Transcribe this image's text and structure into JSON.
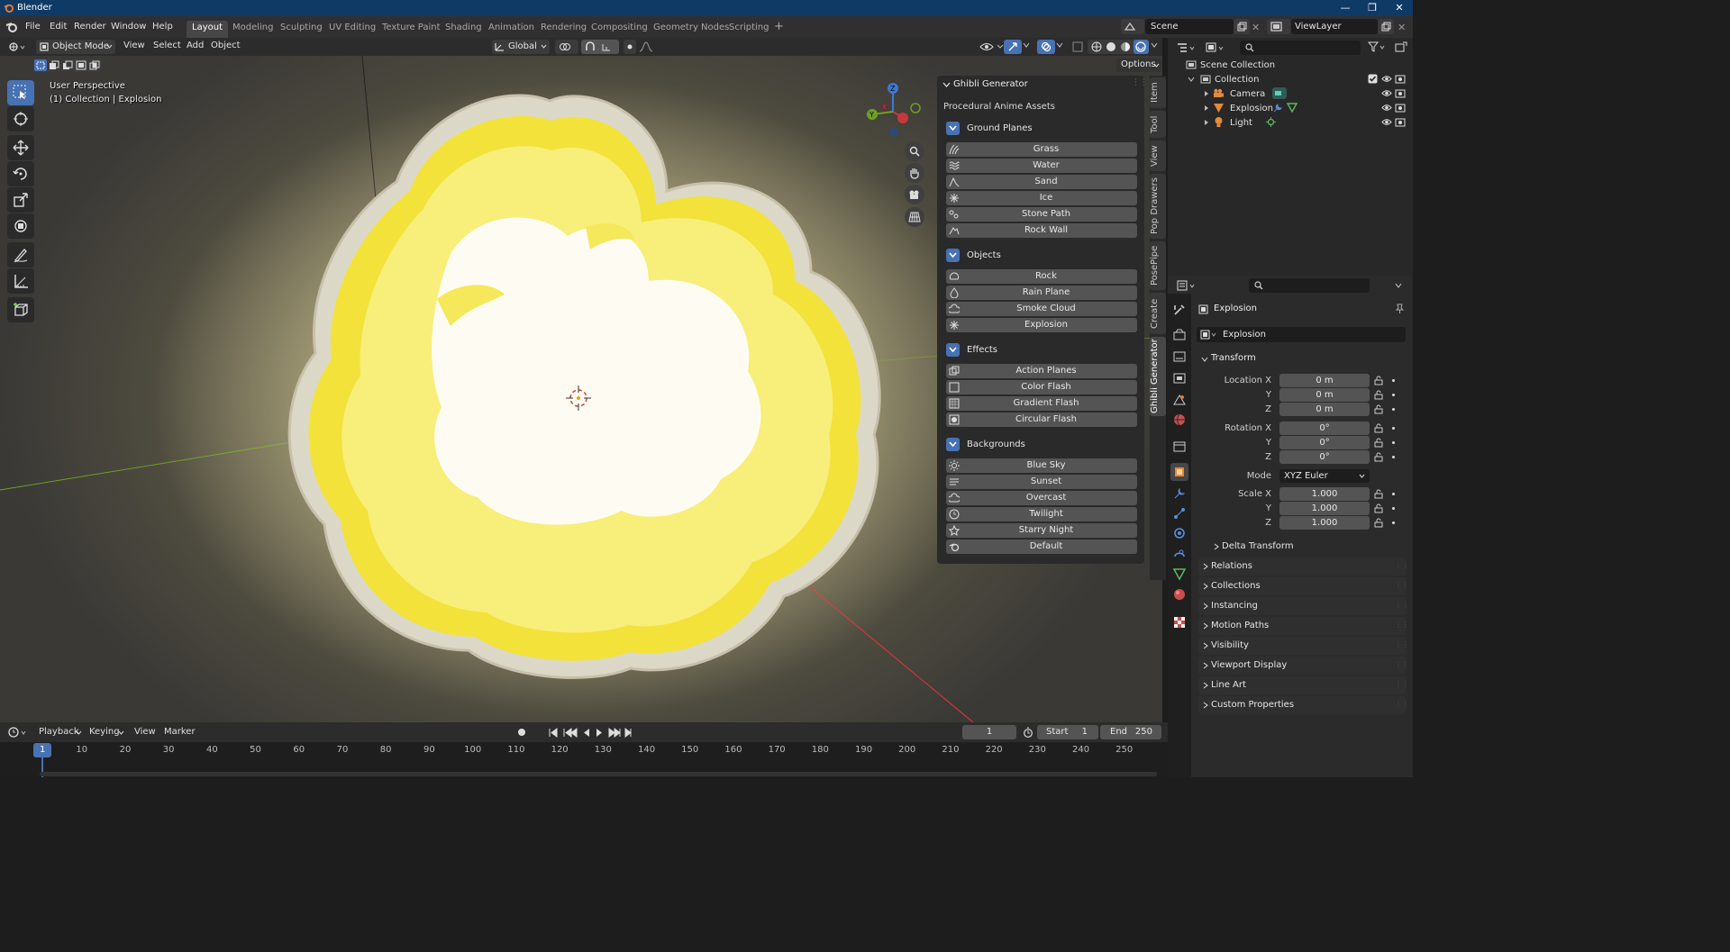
{
  "window": {
    "title": "Blender"
  },
  "menu": {
    "items": [
      "File",
      "Edit",
      "Render",
      "Window",
      "Help"
    ]
  },
  "workspaces": [
    {
      "label": "Layout",
      "active": true
    },
    {
      "label": "Modeling"
    },
    {
      "label": "Sculpting"
    },
    {
      "label": "UV Editing"
    },
    {
      "label": "Texture Paint"
    },
    {
      "label": "Shading"
    },
    {
      "label": "Animation"
    },
    {
      "label": "Rendering"
    },
    {
      "label": "Compositing"
    },
    {
      "label": "Geometry Nodes"
    },
    {
      "label": "Scripting"
    }
  ],
  "scene": {
    "name": "Scene",
    "view_layer": "ViewLayer"
  },
  "viewport_header": {
    "mode": "Object Mode",
    "menus": [
      "View",
      "Select",
      "Add",
      "Object"
    ],
    "orientation": "Global",
    "options": "Options"
  },
  "viewport": {
    "perspective": "User Perspective",
    "collection_info": "(1) Collection | Explosion",
    "gizmo_axes": {
      "x": "X",
      "y": "Y",
      "z": "Z"
    }
  },
  "ghibli_panel": {
    "title": "Ghibli Generator",
    "subtitle": "Procedural Anime Assets",
    "sections": [
      {
        "title": "Ground Planes",
        "items": [
          {
            "label": "Grass",
            "icon": "grass-icon"
          },
          {
            "label": "Water",
            "icon": "water-icon"
          },
          {
            "label": "Sand",
            "icon": "sand-icon"
          },
          {
            "label": "Ice",
            "icon": "snowflake-icon"
          },
          {
            "label": "Stone Path",
            "icon": "stone-path-icon"
          },
          {
            "label": "Rock Wall",
            "icon": "rock-wall-icon"
          }
        ]
      },
      {
        "title": "Objects",
        "items": [
          {
            "label": "Rock",
            "icon": "rock-icon"
          },
          {
            "label": "Rain Plane",
            "icon": "raindrop-icon"
          },
          {
            "label": "Smoke Cloud",
            "icon": "cloud-icon"
          },
          {
            "label": "Explosion",
            "icon": "burst-icon"
          }
        ]
      },
      {
        "title": "Effects",
        "items": [
          {
            "label": "Action Planes",
            "icon": "planes-icon"
          },
          {
            "label": "Color Flash",
            "icon": "square-icon"
          },
          {
            "label": "Gradient Flash",
            "icon": "checker-icon"
          },
          {
            "label": "Circular Flash",
            "icon": "circle-square-icon"
          }
        ]
      },
      {
        "title": "Backgrounds",
        "items": [
          {
            "label": "Blue Sky",
            "icon": "sun-icon"
          },
          {
            "label": "Sunset",
            "icon": "sunset-icon"
          },
          {
            "label": "Overcast",
            "icon": "cloud-icon"
          },
          {
            "label": "Twilight",
            "icon": "clock-icon"
          },
          {
            "label": "Starry Night",
            "icon": "star-icon"
          },
          {
            "label": "Default",
            "icon": "blender-icon"
          }
        ]
      }
    ]
  },
  "side_tabs": [
    "Item",
    "Tool",
    "View",
    "Pop Drawers",
    "PosePipe",
    "Create",
    "Ghibli Generator"
  ],
  "timeline": {
    "menus": [
      "Playback",
      "Keying",
      "View",
      "Marker"
    ],
    "current_frame": "1",
    "start_label": "Start",
    "start": "1",
    "end_label": "End",
    "end": "250",
    "ticks": [
      "1",
      "10",
      "20",
      "30",
      "40",
      "50",
      "60",
      "70",
      "80",
      "90",
      "100",
      "110",
      "120",
      "130",
      "140",
      "150",
      "160",
      "170",
      "180",
      "190",
      "200",
      "210",
      "220",
      "230",
      "240",
      "250"
    ]
  },
  "outliner": {
    "root": "Scene Collection",
    "collection": "Collection",
    "objects": [
      "Camera",
      "Explosion",
      "Light"
    ]
  },
  "properties": {
    "object_name": "Explosion",
    "datablock": "Explosion",
    "transform": {
      "title": "Transform",
      "location_label": "Location X",
      "location": [
        "0 m",
        "0 m",
        "0 m"
      ],
      "rotation_label": "Rotation X",
      "rotation": [
        "0°",
        "0°",
        "0°"
      ],
      "mode_label": "Mode",
      "mode": "XYZ Euler",
      "scale_label": "Scale X",
      "scale": [
        "1.000",
        "1.000",
        "1.000"
      ],
      "y_label": "Y",
      "z_label": "Z"
    },
    "delta": "Delta Transform",
    "sections": [
      "Relations",
      "Collections",
      "Instancing",
      "Motion Paths",
      "Visibility",
      "Viewport Display",
      "Line Art",
      "Custom Properties"
    ]
  },
  "colors": {
    "accent": "#4772b3",
    "titlebar": "#0f3a66",
    "explosion_core": "#fffff0",
    "explosion_yellow": "#f7ea2c",
    "x_axis": "#c8383c",
    "y_axis": "#6ea024",
    "z_axis": "#3d78d6"
  }
}
